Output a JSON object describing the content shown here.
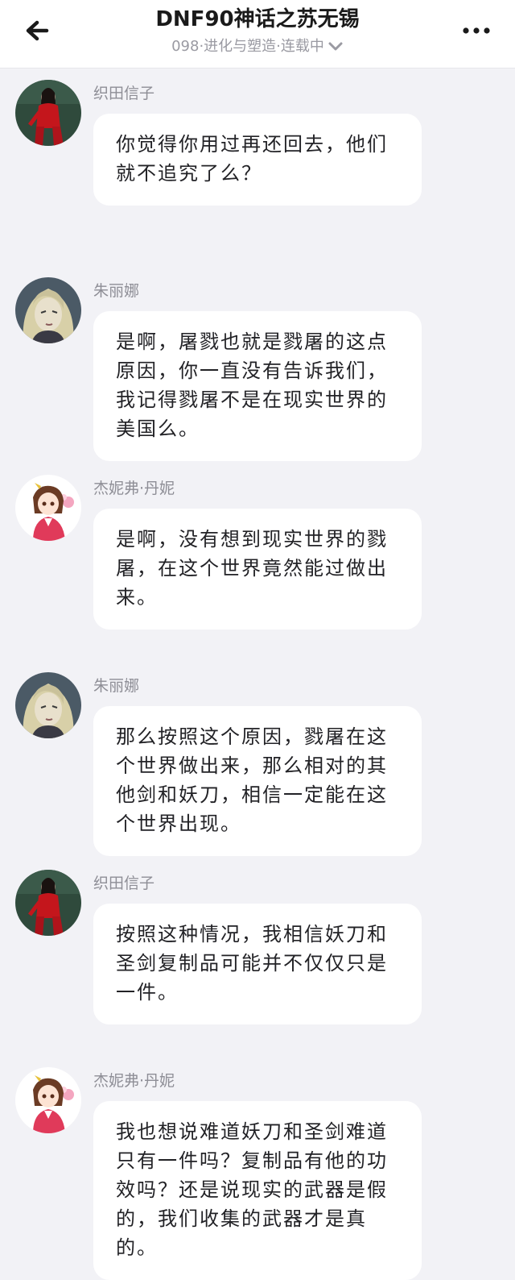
{
  "header": {
    "title": "DNF90神话之苏无锡",
    "subtitle": "098·进化与塑造·连载中",
    "back_icon": "arrow-left-icon",
    "more_icon": "more-dots-icon",
    "chevron_icon": "chevron-down-icon"
  },
  "messages": [
    {
      "sender": "织田信子",
      "avatar": "avatar-red-outfit",
      "text": "你觉得你用过再还回去，他们就不追究了么？"
    },
    {
      "sender": "朱丽娜",
      "avatar": "avatar-blonde-anime",
      "text": "是啊，屠戮也就是戮屠的这点原因，你一直没有告诉我们，我记得戮屠不是在现实世界的美国么。"
    },
    {
      "sender": "杰妮弗·丹妮",
      "avatar": "avatar-anime-girl",
      "text": "是啊，没有想到现实世界的戮屠，在这个世界竟然能过做出来。"
    },
    {
      "sender": "朱丽娜",
      "avatar": "avatar-blonde-anime",
      "text": "那么按照这个原因，戮屠在这个世界做出来，那么相对的其他剑和妖刀，相信一定能在这个世界出现。"
    },
    {
      "sender": "织田信子",
      "avatar": "avatar-red-outfit",
      "text": "按照这种情况，我相信妖刀和圣剑复制品可能并不仅仅只是一件。"
    },
    {
      "sender": "杰妮弗·丹妮",
      "avatar": "avatar-anime-girl",
      "text": "我也想说难道妖刀和圣剑难道只有一件吗？复制品有他的功效吗？还是说现实的武器是假的，我们收集的武器才是真的。"
    }
  ],
  "colors": {
    "background": "#f2f2f6",
    "bubble": "#ffffff",
    "text": "#222226",
    "sender": "#8e8e96"
  }
}
